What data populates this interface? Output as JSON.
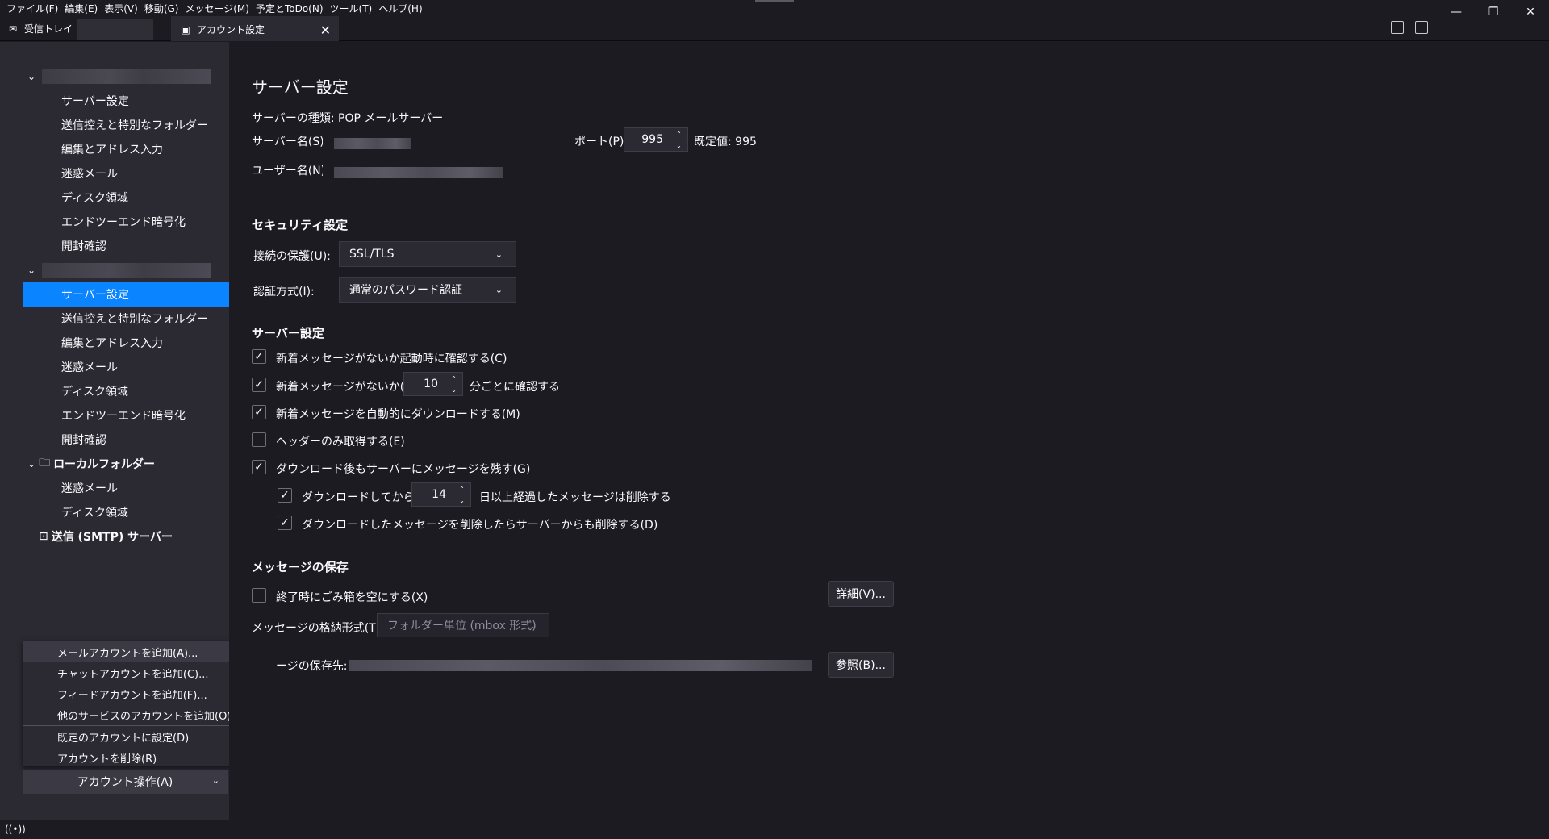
{
  "menu": [
    "ファイル(F)",
    "編集(E)",
    "表示(V)",
    "移動(G)",
    "メッセージ(M)",
    "予定とToDo(N)",
    "ツール(T)",
    "ヘルプ(H)"
  ],
  "tabs": {
    "inbox_label": "受信トレイ",
    "account_label": "アカウント設定"
  },
  "window_controls": {
    "minimize": "—",
    "restore": "❐",
    "close": "✕"
  },
  "sidebar": {
    "account1_items": [
      "サーバー設定",
      "送信控えと特別なフォルダー",
      "編集とアドレス入力",
      "迷惑メール",
      "ディスク領域",
      "エンドツーエンド暗号化",
      "開封確認"
    ],
    "account2_items": [
      "サーバー設定",
      "送信控えと特別なフォルダー",
      "編集とアドレス入力",
      "迷惑メール",
      "ディスク領域",
      "エンドツーエンド暗号化",
      "開封確認"
    ],
    "selected_index": 0,
    "local_folders": "ローカルフォルダー",
    "local_items": [
      "迷惑メール",
      "ディスク領域"
    ],
    "smtp": "送信 (SMTP) サーバー"
  },
  "popup": {
    "group1": [
      "メールアカウントを追加(A)...",
      "チャットアカウントを追加(C)...",
      "フィードアカウントを追加(F)...",
      "他のサービスのアカウントを追加(O)..."
    ],
    "group2": [
      "既定のアカウントに設定(D)",
      "アカウントを削除(R)"
    ],
    "button": "アカウント操作(A)"
  },
  "main": {
    "title": "サーバー設定",
    "server_type": "サーバーの種類: POP メールサーバー",
    "server_name_label": "サーバー名(S):",
    "port_label": "ポート(P):",
    "port_value": "995",
    "port_default": "既定値: 995",
    "user_name_label": "ユーザー名(N):",
    "security_heading": "セキュリティ設定",
    "connection_label": "接続の保護(U):",
    "connection_value": "SSL/TLS",
    "auth_label": "認証方式(I):",
    "auth_value": "通常のパスワード認証",
    "server_heading": "サーバー設定",
    "check_startup": "新着メッセージがないか起動時に確認する(C)",
    "check_every": "新着メッセージがないか(Y)",
    "check_every_value": "10",
    "check_every_suffix": "分ごとに確認する",
    "auto_download": "新着メッセージを自動的にダウンロードする(M)",
    "headers_only": "ヘッダーのみ取得する(E)",
    "leave_on_server": "ダウンロード後もサーバーにメッセージを残す(G)",
    "delete_after": "ダウンロードしてから(O)",
    "delete_after_value": "14",
    "delete_after_suffix": "日以上経過したメッセージは削除する",
    "delete_when_deleted": "ダウンロードしたメッセージを削除したらサーバーからも削除する(D)",
    "storage_heading": "メッセージの保存",
    "empty_trash": "終了時にごみ箱を空にする(X)",
    "advanced_button": "詳細(V)...",
    "store_type_label": "メッセージの格納形式(T):",
    "store_type_value": "フォルダー単位 (mbox 形式)",
    "local_dir_label": "ージの保存先:",
    "browse_button": "参照(B)..."
  },
  "checks": {
    "check_startup": true,
    "check_every": true,
    "auto_download": true,
    "headers_only": false,
    "leave_on_server": true,
    "delete_after": true,
    "delete_when_deleted": true,
    "empty_trash": false
  }
}
